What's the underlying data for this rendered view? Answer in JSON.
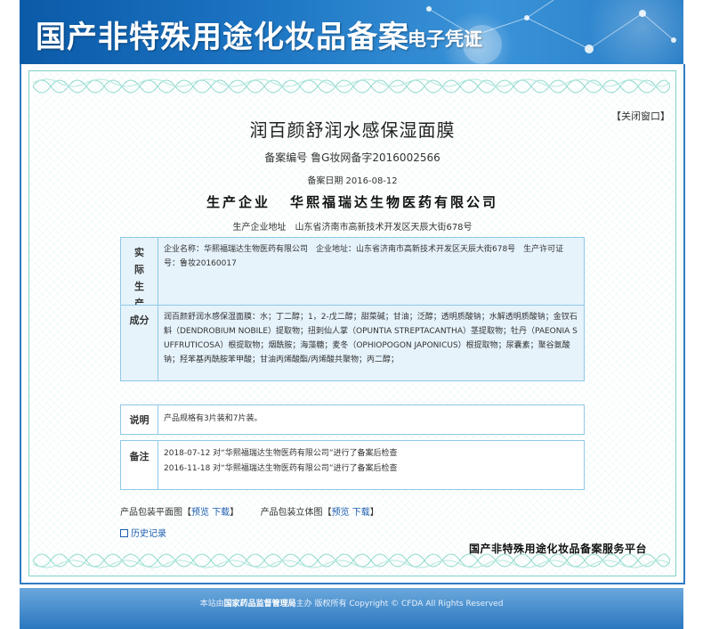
{
  "header": {
    "title": "国产非特殊用途化妆品备案",
    "subtitle": "电子凭证"
  },
  "close_link": {
    "open": "【",
    "label": "关闭窗口",
    "close": "】"
  },
  "certificate": {
    "product_name": "润百颜舒润水感保湿面膜",
    "record_no_label": "备案编号",
    "record_no": "鲁G妆网备字2016002566",
    "record_date_label": "备案日期",
    "record_date": "2016-08-12",
    "producer_label": "生产企业",
    "producer_name": "华熙福瑞达生物医药有限公司",
    "address_label": "生产企业地址",
    "address": "山东省济南市高新技术开发区天辰大街678号"
  },
  "boxes": {
    "enterprise": {
      "label": "实际生产企业",
      "text": "企业名称：华熙福瑞达生物医药有限公司　企业地址：山东省济南市高新技术开发区天辰大街678号　生产许可证号：鲁妆20160017"
    },
    "ingredients": {
      "label": "成分",
      "text": "润百颜舒润水感保湿面膜：水；丁二醇；1，2-戊二醇；甜菜碱；甘油；泛醇；透明质酸钠；水解透明质酸钠；金钗石斛（DENDROBIUM NOBILE）提取物；扭刺仙人掌（OPUNTIA STREPTACANTHA）茎提取物；牡丹（PAEONIA SUFFRUTICOSA）根提取物；烟酰胺；海藻糖；麦冬（OPHIOPOGON JAPONICUS）根提取物；尿囊素；聚谷氨酸钠；羟苯基丙酰胺苯甲酸；甘油丙烯酸酯/丙烯酸共聚物；丙二醇；"
    },
    "notes": {
      "label": "说明",
      "text": "产品规格有3片装和7片装。"
    },
    "remarks": {
      "label": "备注",
      "lines": [
        "2018-07-12 对“华熙福瑞达生物医药有限公司”进行了备案后检查",
        "2016-11-18 对“华熙福瑞达生物医药有限公司”进行了备案后检查"
      ]
    }
  },
  "packaging": {
    "flat_label": "产品包装平面图",
    "solid_label": "产品包装立体图",
    "open_bracket": "【",
    "close_bracket": "】",
    "preview": "预览",
    "download": "下载"
  },
  "history": {
    "label": "历史记录"
  },
  "platform": "国产非特殊用途化妆品备案服务平台",
  "footer": {
    "prefix": "本站由",
    "org": "国家药品监督管理局",
    "suffix": "主办 版权所有 Copyright © CFDA All Rights Reserved"
  },
  "colors": {
    "header_blue": "#1c74c2",
    "box_border": "#8ec9e8",
    "box_fill": "#e6f3fb",
    "link_blue": "#1d5cae",
    "guilloche": "#7fd3c8"
  }
}
